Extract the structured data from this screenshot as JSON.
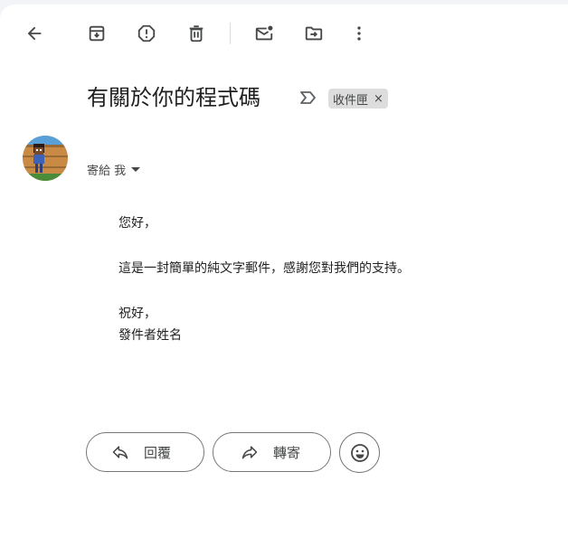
{
  "toolbar": {
    "icons": [
      "back-arrow-icon",
      "archive-icon",
      "report-spam-icon",
      "trash-icon",
      "mark-unread-icon",
      "move-to-icon",
      "more-vert-icon"
    ]
  },
  "email": {
    "subject": "有關於你的程式碼",
    "label": "收件匣",
    "label_close": "×",
    "sender_name": "",
    "recipient": "寄給 我",
    "body": {
      "greeting": "您好，",
      "line1": "這是一封簡單的純文字郵件，感謝您對我們的支持。",
      "closing": "祝好，",
      "signature": "發件者姓名"
    }
  },
  "actions": {
    "reply_label": "回覆",
    "forward_label": "轉寄"
  },
  "colors": {
    "icon": "#444746",
    "chip_bg": "#dddddd",
    "background": "#f2f4f8"
  }
}
